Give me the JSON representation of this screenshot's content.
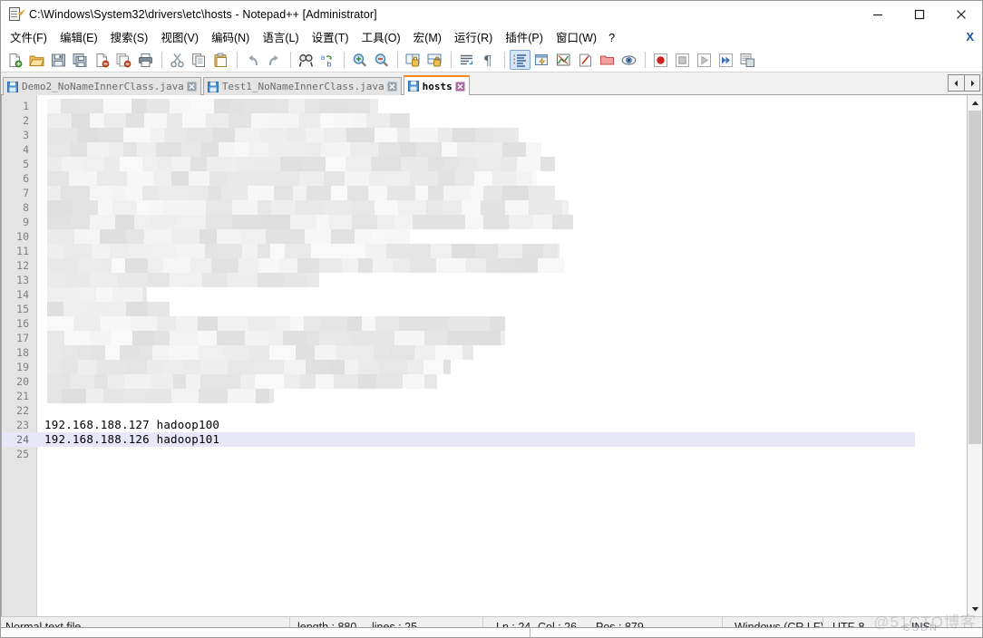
{
  "window": {
    "title": "C:\\Windows\\System32\\drivers\\etc\\hosts - Notepad++ [Administrator]",
    "icon": "notepad-document-icon",
    "controls": {
      "minimize": "minimize-icon",
      "maximize": "maximize-icon",
      "close": "close-icon"
    }
  },
  "menubar": {
    "items": [
      {
        "label": "文件(F)",
        "name": "menu-file"
      },
      {
        "label": "编辑(E)",
        "name": "menu-edit"
      },
      {
        "label": "搜索(S)",
        "name": "menu-search"
      },
      {
        "label": "视图(V)",
        "name": "menu-view"
      },
      {
        "label": "编码(N)",
        "name": "menu-encoding"
      },
      {
        "label": "语言(L)",
        "name": "menu-language"
      },
      {
        "label": "设置(T)",
        "name": "menu-settings"
      },
      {
        "label": "工具(O)",
        "name": "menu-tools"
      },
      {
        "label": "宏(M)",
        "name": "menu-macro"
      },
      {
        "label": "运行(R)",
        "name": "menu-run"
      },
      {
        "label": "插件(P)",
        "name": "menu-plugins"
      },
      {
        "label": "窗口(W)",
        "name": "menu-window"
      },
      {
        "label": "?",
        "name": "menu-help"
      }
    ],
    "close_document": "X"
  },
  "toolbar": {
    "groups": [
      [
        "new-file-icon",
        "open-file-icon",
        "save-icon",
        "save-all-icon",
        "close-file-icon",
        "close-all-files-icon",
        "print-icon"
      ],
      [
        "cut-icon",
        "copy-icon",
        "paste-icon"
      ],
      [
        "undo-icon",
        "redo-icon"
      ],
      [
        "find-icon",
        "replace-icon"
      ],
      [
        "zoom-in-icon",
        "zoom-out-icon"
      ],
      [
        "sync-vertical-scroll-icon",
        "sync-horizontal-scroll-icon"
      ],
      [
        "word-wrap-icon",
        "show-all-characters-icon"
      ],
      [
        "indent-guide-icon",
        "user-defined-dialog-icon",
        "show-function-list-icon",
        "document-map-icon",
        "folder-as-workspace-icon",
        "monitoring-icon"
      ],
      [
        "start-recording-macro-icon",
        "stop-recording-macro-icon",
        "play-macro-icon",
        "play-macro-multiple-icon",
        "save-macro-icon"
      ]
    ],
    "active_icon": "indent-guide-icon"
  },
  "tabs": {
    "items": [
      {
        "label": "Demo2_NoNameInnerClass.java",
        "active": false
      },
      {
        "label": "Test1_NoNameInnerClass.java",
        "active": false
      },
      {
        "label": "hosts",
        "active": true
      }
    ],
    "scroll_left": "scroll-tabs-left-icon",
    "scroll_right": "scroll-tabs-right-icon"
  },
  "editor": {
    "total_lines": 25,
    "current_line": 24,
    "lines": [
      {
        "n": 1,
        "text": "",
        "censored": true
      },
      {
        "n": 2,
        "text": "",
        "censored": true
      },
      {
        "n": 3,
        "text": "",
        "censored": true
      },
      {
        "n": 4,
        "text": "",
        "censored": true
      },
      {
        "n": 5,
        "text": "",
        "censored": true
      },
      {
        "n": 6,
        "text": "",
        "censored": true
      },
      {
        "n": 7,
        "text": "",
        "censored": true
      },
      {
        "n": 8,
        "text": "",
        "censored": true
      },
      {
        "n": 9,
        "text": "",
        "censored": true
      },
      {
        "n": 10,
        "text": "",
        "censored": true
      },
      {
        "n": 11,
        "text": "",
        "censored": true
      },
      {
        "n": 12,
        "text": "",
        "censored": true
      },
      {
        "n": 13,
        "text": "",
        "censored": true
      },
      {
        "n": 14,
        "text": "",
        "censored": true
      },
      {
        "n": 15,
        "text": "",
        "censored": true
      },
      {
        "n": 16,
        "text": "",
        "censored": true
      },
      {
        "n": 17,
        "text": "",
        "censored": true
      },
      {
        "n": 18,
        "text": "",
        "censored": true
      },
      {
        "n": 19,
        "text": "",
        "censored": true
      },
      {
        "n": 20,
        "text": "",
        "censored": true
      },
      {
        "n": 21,
        "text": "",
        "censored": true
      },
      {
        "n": 22,
        "text": "",
        "censored": false
      },
      {
        "n": 23,
        "text": "192.168.188.127 hadoop100",
        "censored": false
      },
      {
        "n": 24,
        "text": "192.168.188.126 hadoop101",
        "censored": false
      },
      {
        "n": 25,
        "text": "",
        "censored": false
      }
    ]
  },
  "statusbar": {
    "file_type": "Normal text file",
    "length_label": "length : 880",
    "lines_label": "lines : 25",
    "ln": "Ln : 24",
    "col": "Col : 26",
    "pos": "Pos : 879",
    "eol": "Windows (CR LF)",
    "encoding": "UTF-8",
    "insert_mode": "INS"
  },
  "watermark": {
    "primary": "@51CTO博客",
    "secondary": "CSDN"
  },
  "colors": {
    "accent_tab": "#ff8c1a",
    "current_line": "#e7e7f7",
    "gutter_bg": "#e4e4e4",
    "toolbar_active": "#d4e6f7"
  }
}
